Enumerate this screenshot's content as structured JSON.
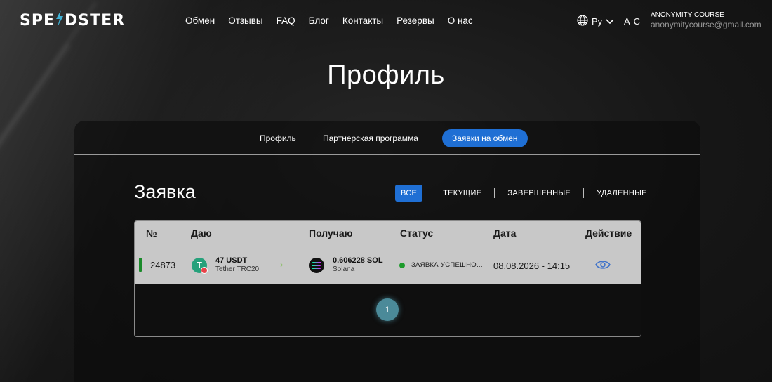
{
  "brand": {
    "logo_left": "SPE",
    "logo_right": "DSTER",
    "accent": "#3fb2d6"
  },
  "nav": {
    "items": [
      {
        "label": "Обмен"
      },
      {
        "label": "Отзывы"
      },
      {
        "label": "FAQ"
      },
      {
        "label": "Блог"
      },
      {
        "label": "Контакты"
      },
      {
        "label": "Резервы"
      },
      {
        "label": "О нас"
      }
    ]
  },
  "language": {
    "icon": "globe-icon",
    "value": "Ру",
    "dropdown_icon": "chevron-down-icon"
  },
  "user": {
    "initials": "A C",
    "name": "ANONYMITY COURSE",
    "email": "anonymitycourse@gmail.com"
  },
  "page": {
    "title": "Профиль"
  },
  "profile_tabs": {
    "items": [
      {
        "label": "Профиль",
        "active": false
      },
      {
        "label": "Партнерская программа",
        "active": false
      },
      {
        "label": "Заявки на обмен",
        "active": true
      }
    ],
    "active_color": "#1f6fd4"
  },
  "orders": {
    "title": "Заявка",
    "filters": [
      {
        "label": "ВСЕ",
        "active": true
      },
      {
        "label": "ТЕКУЩИЕ",
        "active": false
      },
      {
        "label": "ЗАВЕРШЕННЫЕ",
        "active": false
      },
      {
        "label": "УДАЛЕННЫЕ",
        "active": false
      }
    ],
    "columns": [
      "№",
      "Даю",
      "Получаю",
      "Статус",
      "Дата",
      "Действие"
    ],
    "rows": [
      {
        "id": "24873",
        "give_amount": "47 USDT",
        "give_name": "Tether TRC20",
        "give_icon": "tether-icon",
        "receive_amount": "0.606228 SOL",
        "receive_name": "Solana",
        "receive_icon": "solana-icon",
        "status": "ЗАЯВКА УСПЕШНО...",
        "status_color": "#1c9b2b",
        "date": "08.08.2026 - 14:15",
        "action_icon": "eye-icon"
      }
    ],
    "pagination": {
      "current": "1"
    }
  }
}
